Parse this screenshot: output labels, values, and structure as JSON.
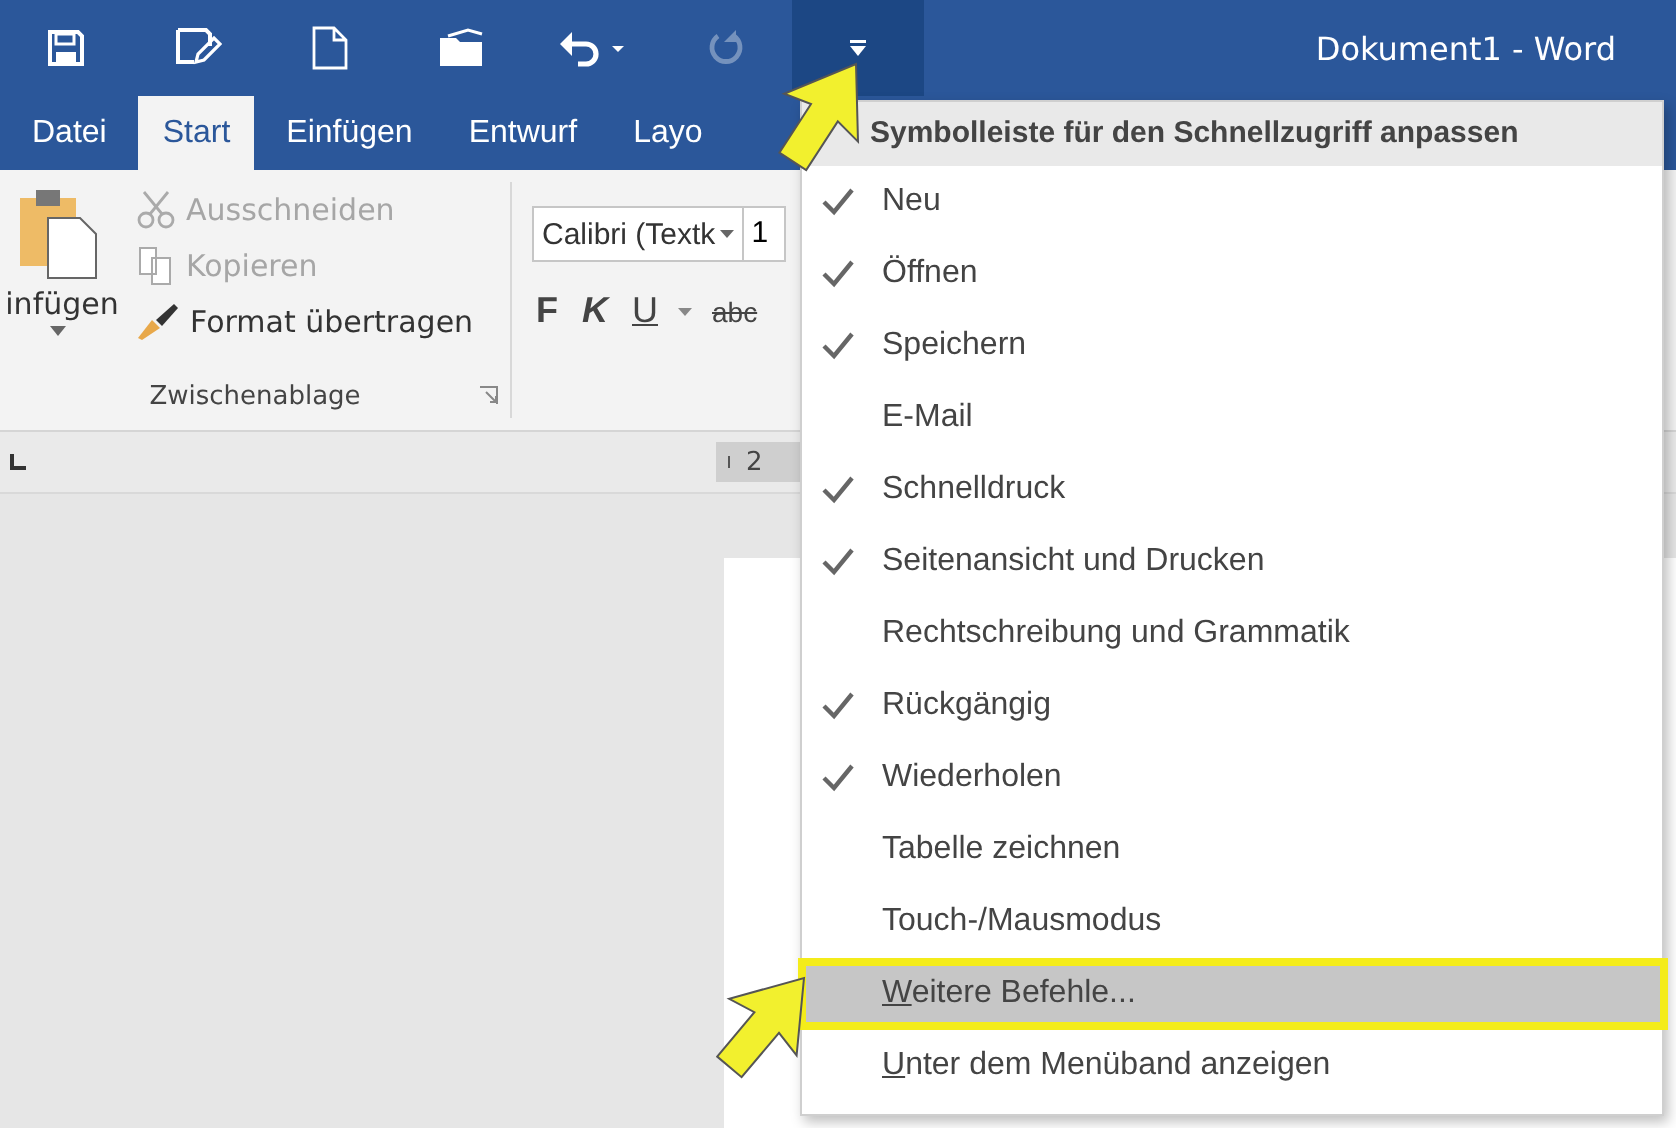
{
  "title_bar": {
    "title": "Dokument1 - Word",
    "quick_access": [
      {
        "kind": "save",
        "disabled": false,
        "active": false
      },
      {
        "kind": "save_edit",
        "disabled": false,
        "active": false
      },
      {
        "kind": "new",
        "disabled": false,
        "active": false
      },
      {
        "kind": "open",
        "disabled": false,
        "active": false
      },
      {
        "kind": "undo",
        "disabled": false,
        "active": false
      },
      {
        "kind": "redo",
        "disabled": true,
        "active": false
      },
      {
        "kind": "customize",
        "disabled": false,
        "active": true
      }
    ]
  },
  "tabs": [
    {
      "label": "Datei",
      "selected": false
    },
    {
      "label": "Start",
      "selected": true
    },
    {
      "label": "Einfügen",
      "selected": false
    },
    {
      "label": "Entwurf",
      "selected": false
    },
    {
      "label": "Layo",
      "selected": false
    }
  ],
  "ribbon": {
    "clipboard": {
      "paste": "infügen",
      "group_label": "Zwischenablage",
      "commands": [
        {
          "label": "Ausschneiden",
          "kind": "cut",
          "disabled": true
        },
        {
          "label": "Kopieren",
          "kind": "copy",
          "disabled": true
        },
        {
          "label": "Format übertragen",
          "kind": "brush",
          "disabled": false
        }
      ]
    },
    "font": {
      "font_name": "Calibri (Textk",
      "font_size": "1",
      "styles": [
        {
          "label": "F",
          "kind": "bold"
        },
        {
          "label": "K",
          "kind": "italic"
        },
        {
          "label": "U",
          "kind": "underline"
        },
        {
          "label": "abc",
          "kind": "strike"
        }
      ]
    }
  },
  "ruler": {
    "mark": "2"
  },
  "menu": {
    "title": "Symbolleiste für den Schnellzugriff anpassen",
    "items": [
      {
        "label": "Neu",
        "checked": true,
        "selected": false,
        "mnemonic": false
      },
      {
        "label": "Öffnen",
        "checked": true,
        "selected": false,
        "mnemonic": false
      },
      {
        "label": "Speichern",
        "checked": true,
        "selected": false,
        "mnemonic": false
      },
      {
        "label": "E-Mail",
        "checked": false,
        "selected": false,
        "mnemonic": false
      },
      {
        "label": "Schnelldruck",
        "checked": true,
        "selected": false,
        "mnemonic": false
      },
      {
        "label": "Seitenansicht und Drucken",
        "checked": true,
        "selected": false,
        "mnemonic": false
      },
      {
        "label": "Rechtschreibung und Grammatik",
        "checked": false,
        "selected": false,
        "mnemonic": false
      },
      {
        "label": "Rückgängig",
        "checked": true,
        "selected": false,
        "mnemonic": false
      },
      {
        "label": "Wiederholen",
        "checked": true,
        "selected": false,
        "mnemonic": false
      },
      {
        "label": "Tabelle zeichnen",
        "checked": false,
        "selected": false,
        "mnemonic": false
      },
      {
        "label": "Touch-/Mausmodus",
        "checked": false,
        "selected": false,
        "mnemonic": false
      },
      {
        "label": "Weitere Befehle...",
        "checked": false,
        "selected": true,
        "mnemonic": true
      },
      {
        "label": "Unter dem Menüband anzeigen",
        "checked": false,
        "selected": false,
        "mnemonic": true
      }
    ]
  }
}
